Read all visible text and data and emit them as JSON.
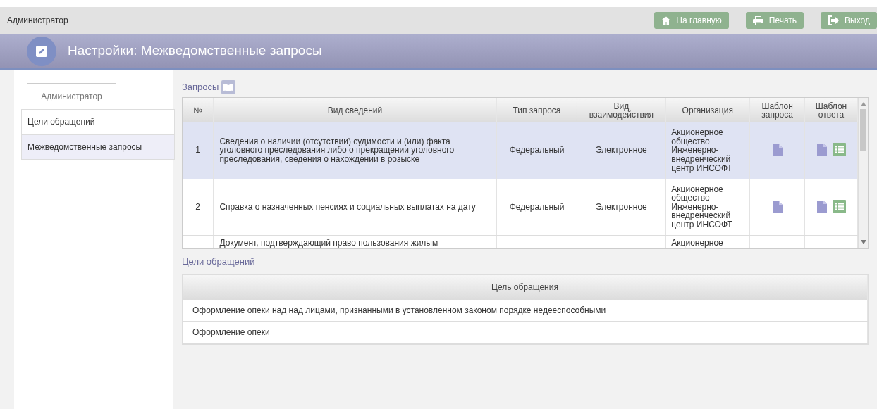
{
  "topbar": {
    "user": "Администратор",
    "buttons": [
      {
        "kind": "home",
        "label": "На главную"
      },
      {
        "kind": "print",
        "label": "Печать"
      },
      {
        "kind": "exit",
        "label": "Выход"
      }
    ]
  },
  "header": {
    "title": "Настройки: Межведомственные запросы"
  },
  "sidebar": {
    "tab": "Администратор",
    "items": [
      {
        "label": "Цели обращений",
        "selected": false
      },
      {
        "label": "Межведомственные запросы",
        "selected": true
      }
    ]
  },
  "requests": {
    "title": "Запросы",
    "columns": [
      "№",
      "Вид сведений",
      "Тип запроса",
      "Вид взаимодействия",
      "Организация",
      "Шаблон запроса",
      "Шаблон ответа"
    ],
    "rows": [
      {
        "number": "1",
        "info": "Сведения о наличии (отсутствии) судимости и (или) факта уголовного преследования либо о прекращении уголовного преследования, сведения о нахождении в розыске",
        "type": "Федеральный",
        "interaction": "Электронное",
        "organization": "Акционерное общество Инженерно-внедренческий центр ИНСОФТ",
        "selected": true
      },
      {
        "number": "2",
        "info": "Справка о назначенных пенсиях и социальных выплатах на дату",
        "type": "Федеральный",
        "interaction": "Электронное",
        "organization": "Акционерное общество Инженерно-внедренческий центр ИНСОФТ",
        "selected": false
      },
      {
        "number": "",
        "info": "Документ, подтверждающий право пользования жилым",
        "type": "",
        "interaction": "",
        "organization": "Акционерное",
        "selected": false
      }
    ]
  },
  "goals": {
    "title": "Цели обращений",
    "column": "Цель обращения",
    "rows": [
      "Оформление опеки над над лицами, признанными в установленном законом порядке недееспособными",
      "Оформление опеки"
    ]
  }
}
